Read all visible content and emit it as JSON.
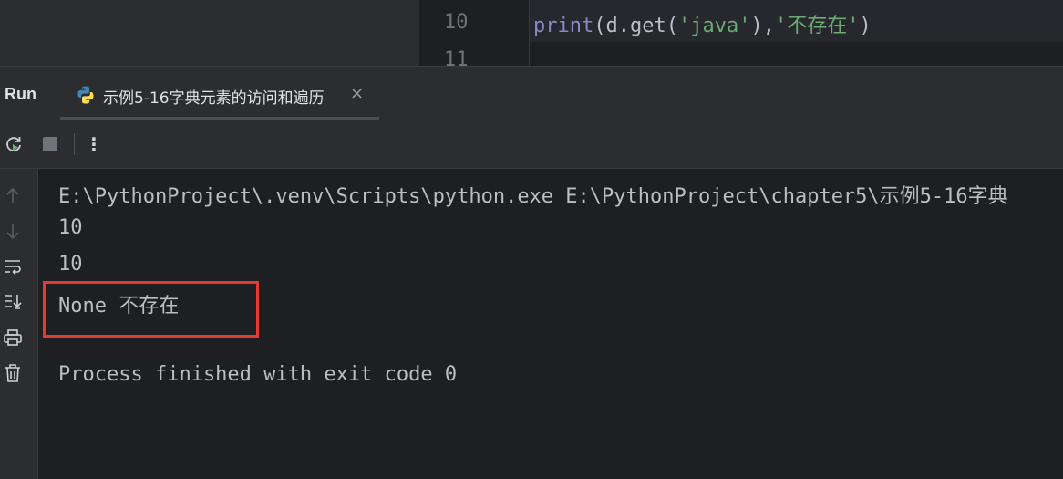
{
  "editor": {
    "line_numbers": [
      "10",
      "11"
    ],
    "code_line": {
      "fn": "print",
      "p1": "(d.",
      "method": "get",
      "p2": "(",
      "s1": "'java'",
      "p3": "),",
      "s2": "'不存在'",
      "p4": ")"
    }
  },
  "run_panel": {
    "label": "Run",
    "tab_title": "示例5-16字典元素的访问和遍历",
    "tab_close": "×",
    "toolbar": {
      "icons": [
        "rerun-icon",
        "stop-icon",
        "more-options-icon"
      ],
      "more_glyph": "⋮"
    },
    "side_icons": [
      "scroll-up-icon",
      "scroll-down-icon",
      "soft-wrap-icon",
      "scroll-to-end-icon",
      "print-icon",
      "trash-icon"
    ]
  },
  "console": {
    "lines": [
      "E:\\PythonProject\\.venv\\Scripts\\python.exe E:\\PythonProject\\chapter5\\示例5-16字典",
      "10",
      "10",
      "None 不存在",
      "Process finished with exit code 0"
    ]
  },
  "colors": {
    "background": "#1e1f22",
    "panel": "#2b2d30",
    "string": "#6aab73",
    "builtin": "#8888c6",
    "highlight_box": "#e53935"
  }
}
